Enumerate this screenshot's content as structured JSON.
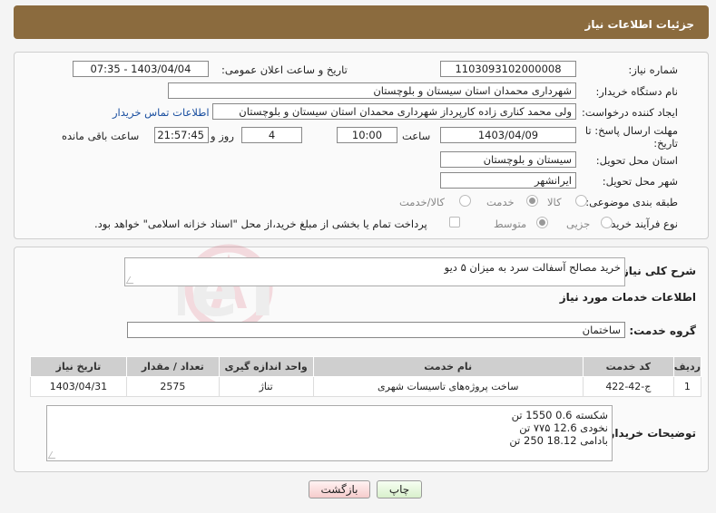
{
  "header": {
    "title": "جزئیات اطلاعات نیاز"
  },
  "info": {
    "need_number_label": "شماره نیاز:",
    "need_number": "1103093102000008",
    "announce_label": "تاریخ و ساعت اعلان عمومی:",
    "announce_value": "1403/04/04 - 07:35",
    "buyer_org_label": "نام دستگاه خریدار:",
    "buyer_org": "شهرداری محمدان استان سیستان و بلوچستان",
    "creator_label": "ایجاد کننده درخواست:",
    "creator": "ولی محمد کناری زاده کارپرداز شهرداری محمدان استان سیستان و بلوچستان",
    "contact_link": "اطلاعات تماس خریدار",
    "deadline_label": "مهلت ارسال پاسخ: تا تاریخ:",
    "deadline_date": "1403/04/09",
    "time_label": "ساعت",
    "deadline_time": "10:00",
    "days_value": "4",
    "days_label": "روز و",
    "remaining_time": "21:57:45",
    "remaining_label": "ساعت باقی مانده",
    "province_label": "استان محل تحویل:",
    "province": "سیستان و بلوچستان",
    "city_label": "شهر محل تحویل:",
    "city": "ایرانشهر",
    "category_label": "طبقه بندی موضوعی:",
    "category_options": [
      "کالا",
      "خدمت",
      "کالا/خدمت"
    ],
    "purchase_type_label": "نوع فرآیند خرید :",
    "purchase_options": [
      "جزیی",
      "متوسط"
    ],
    "payment_note": "پرداخت تمام یا بخشی از مبلغ خرید،از محل \"اسناد خزانه اسلامی\" خواهد بود."
  },
  "summary": {
    "label": "شرح کلی نیاز:",
    "value": "خرید مصالح آسفالت سرد به میزان ۵ دیو"
  },
  "services": {
    "title": "اطلاعات خدمات مورد نیاز",
    "group_label": "گروه خدمت:",
    "group_value": "ساختمان",
    "columns": [
      "ردیف",
      "کد خدمت",
      "نام خدمت",
      "واحد اندازه گیری",
      "تعداد / مقدار",
      "تاریخ نیاز"
    ],
    "rows": [
      [
        "1",
        "ج-42-422",
        "ساخت پروژه‌های تاسیسات شهری",
        "تناژ",
        "2575",
        "1403/04/31"
      ]
    ]
  },
  "buyer_notes": {
    "label": "توضیحات خریدار:",
    "lines": [
      "شکسته 0.6 1550 تن",
      "نخودی 12.6 ۷۷۵ تن",
      "بادامی 18.12 250 تن"
    ]
  },
  "buttons": {
    "print": "چاپ",
    "back": "بازگشت"
  },
  "watermark": {
    "text": "AriaTender.neT"
  }
}
